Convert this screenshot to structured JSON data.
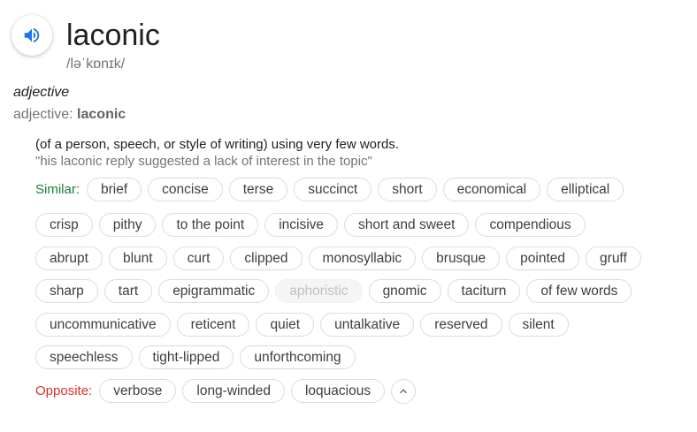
{
  "entry": {
    "word": "laconic",
    "phonetic": "/ləˈkɒnɪk/",
    "part_of_speech": "adjective",
    "pos_label": "adjective:",
    "pos_word": "laconic",
    "definition": "(of a person, speech, or style of writing) using very few words.",
    "example": "\"his laconic reply suggested a lack of interest in the topic\""
  },
  "similar": {
    "label": "Similar:",
    "rows": [
      [
        "brief",
        "concise",
        "terse",
        "succinct",
        "short",
        "economical",
        "elliptical"
      ],
      [
        "crisp",
        "pithy",
        "to the point",
        "incisive",
        "short and sweet",
        "compendious"
      ],
      [
        "abrupt",
        "blunt",
        "curt",
        "clipped",
        "monosyllabic",
        "brusque",
        "pointed",
        "gruff"
      ],
      [
        "sharp",
        "tart",
        "epigrammatic",
        "aphoristic",
        "gnomic",
        "taciturn",
        "of few words"
      ],
      [
        "uncommunicative",
        "reticent",
        "quiet",
        "untalkative",
        "reserved",
        "silent"
      ],
      [
        "speechless",
        "tight-lipped",
        "unforthcoming"
      ]
    ]
  },
  "opposite": {
    "label": "Opposite:",
    "words": [
      "verbose",
      "long-winded",
      "loquacious"
    ]
  },
  "colors": {
    "similar_label": "#1a7f37",
    "opposite_label": "#d93025",
    "speaker_icon": "#1a73e8"
  },
  "icons": {
    "speaker": "speaker-icon",
    "collapse": "chevron-up-icon"
  }
}
